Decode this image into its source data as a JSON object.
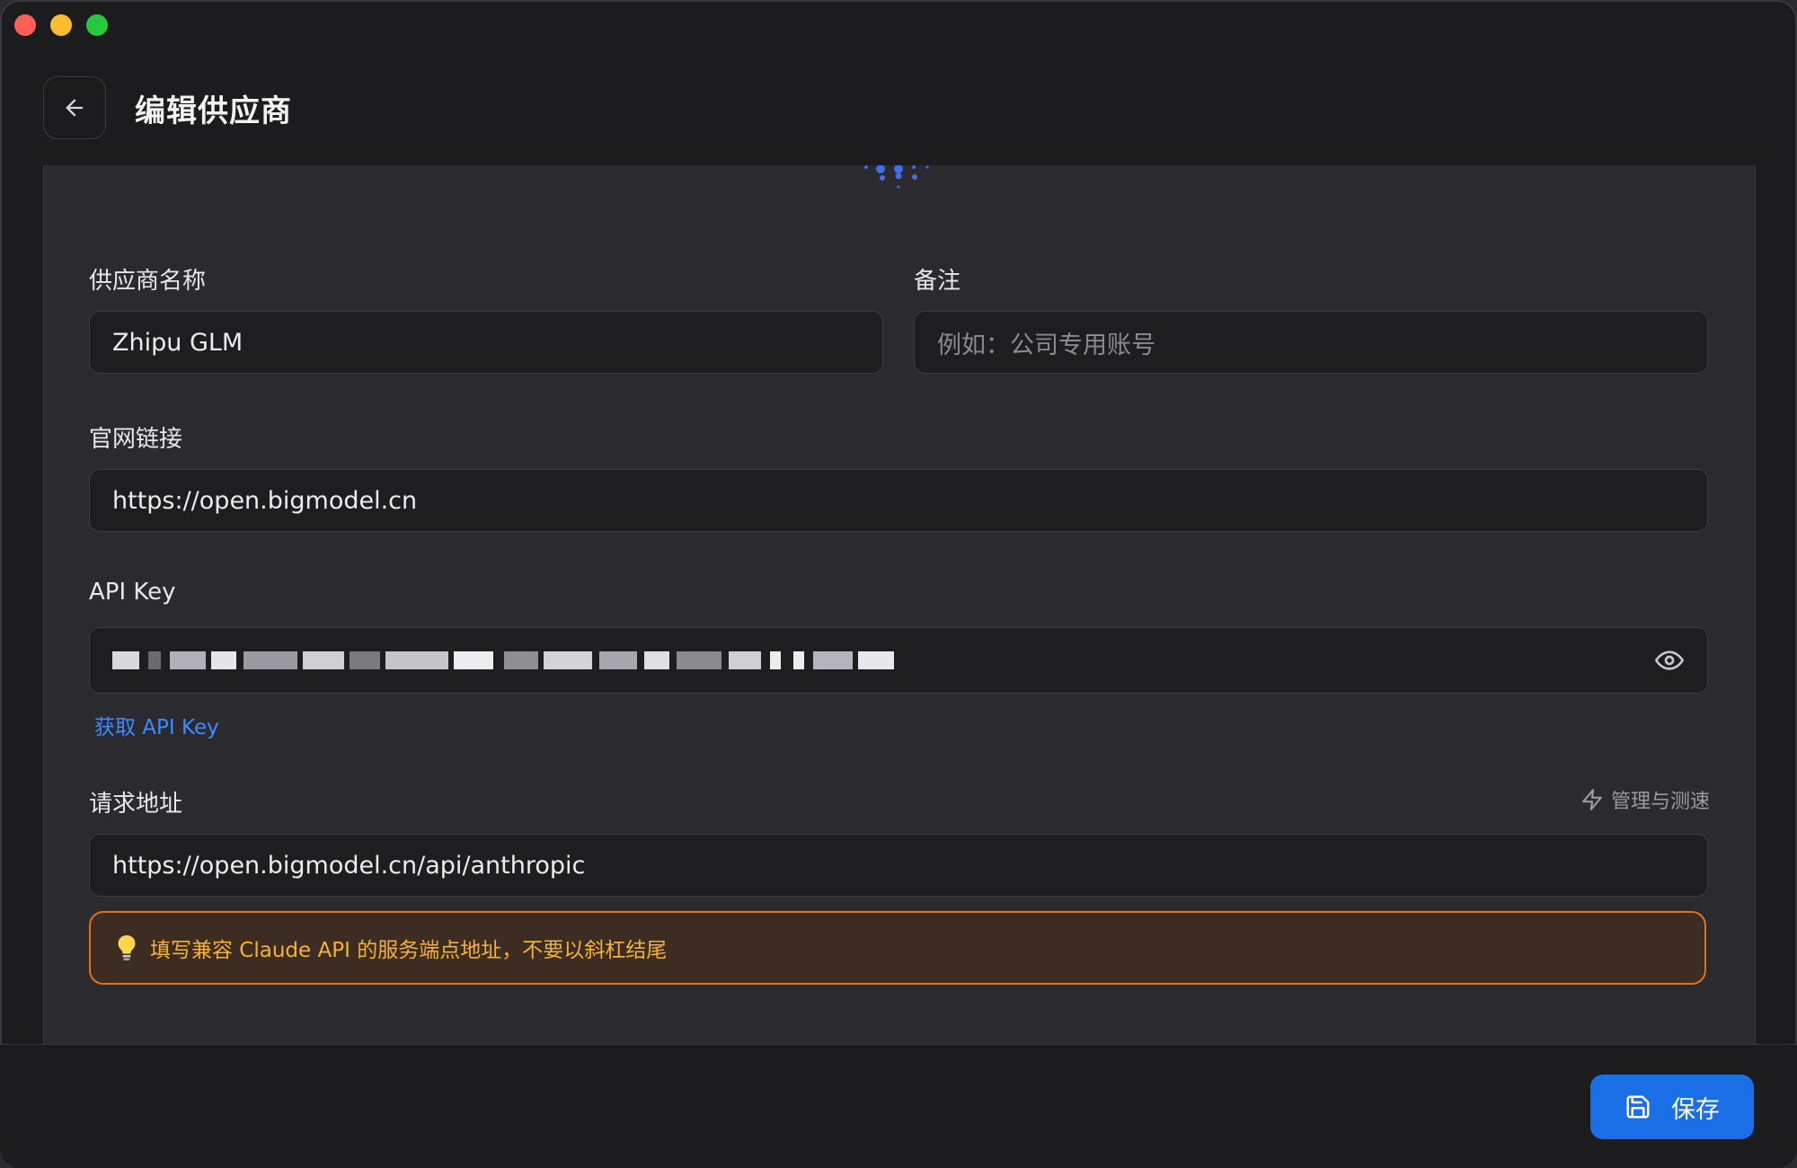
{
  "header": {
    "title": "编辑供应商"
  },
  "form": {
    "name_label": "供应商名称",
    "name_value": "Zhipu GLM",
    "note_label": "备注",
    "note_placeholder": "例如：公司专用账号",
    "website_label": "官网链接",
    "website_value": "https://open.bigmodel.cn",
    "api_key_label": "API Key",
    "api_key_link": "获取 API Key",
    "endpoint_label": "请求地址",
    "endpoint_manage": "管理与测速",
    "endpoint_value": "https://open.bigmodel.cn/api/anthropic",
    "hint_text": "填写兼容 Claude API 的服务端点地址，不要以斜杠结尾"
  },
  "footer": {
    "save_label": "保存"
  },
  "colors": {
    "accent": "#1a6fe6",
    "link": "#3d8bff",
    "warning_border": "#e0731c",
    "warning_text": "#f5b233"
  },
  "icons": {
    "back": "arrow-left-icon",
    "eye": "eye-icon",
    "manage": "lightning-icon",
    "hint": "lightbulb-icon",
    "save": "floppy-disk-icon"
  }
}
